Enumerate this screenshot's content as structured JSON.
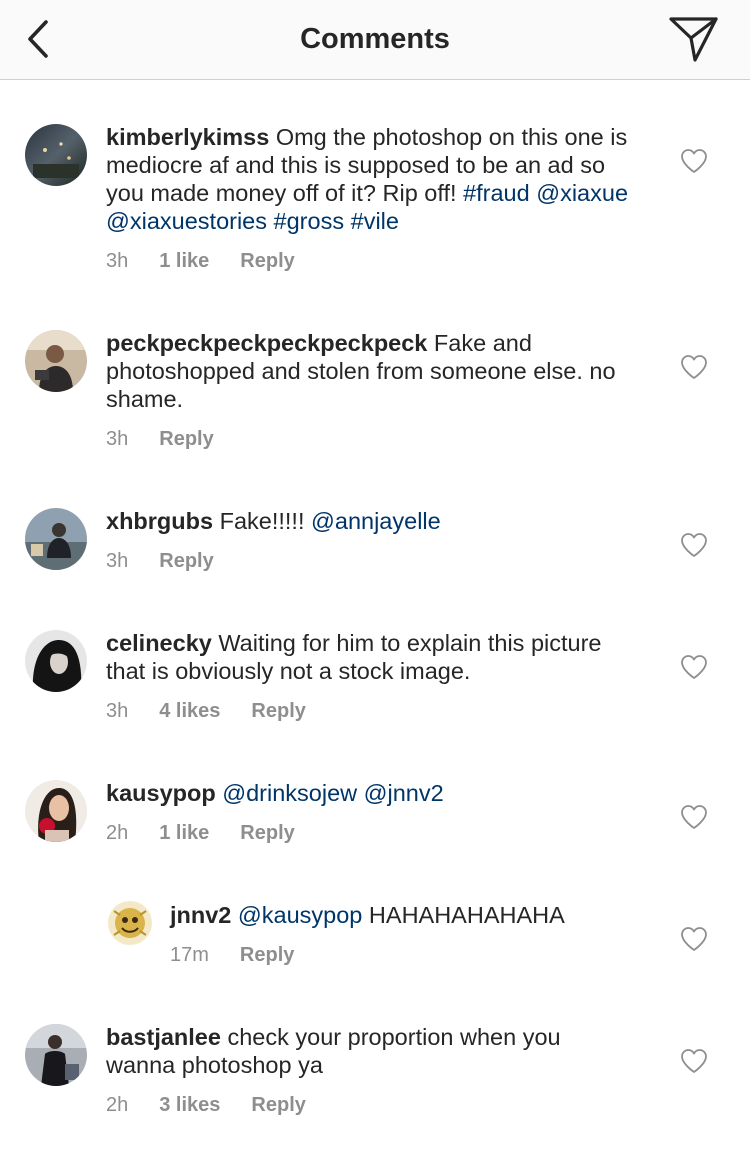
{
  "header": {
    "title": "Comments",
    "back_icon": "chevron-left-icon",
    "send_icon": "paper-plane-icon"
  },
  "colors": {
    "text": "#262626",
    "secondary": "#8e8e8e",
    "link": "#003569",
    "header_bg": "#fafafa",
    "divider": "#cfcfcf"
  },
  "comments": [
    {
      "username": "kimberlykimss",
      "text_before": " Omg the photoshop on this one is mediocre af and this is supposed to be an ad so you made money off of it? Rip off! ",
      "tags": [
        "#fraud",
        "@xiaxue",
        "@xiaxuestories",
        "#gross",
        "#vile"
      ],
      "time": "3h",
      "likes": "1 like",
      "reply": "Reply"
    },
    {
      "username": "peckpeckpeckpeckpeckpeck",
      "text": " Fake and photoshopped and stolen from someone else. no shame.",
      "time": "3h",
      "reply": "Reply"
    },
    {
      "username": "xhbrgubs",
      "text": " Fake!!!!! ",
      "mention": "@annjayelle",
      "time": "3h",
      "reply": "Reply"
    },
    {
      "username": "celinecky",
      "text": " Waiting for him to explain this picture that is obviously not a stock image.",
      "time": "3h",
      "likes": "4 likes",
      "reply": "Reply"
    },
    {
      "username": "kausypop",
      "mentions": [
        "@drinksojew",
        "@jnnv2"
      ],
      "time": "2h",
      "likes": "1 like",
      "reply": "Reply"
    },
    {
      "username": "jnnv2",
      "mention": "@kausypop",
      "text": " HAHAHAHAHAHA",
      "time": "17m",
      "reply": "Reply"
    },
    {
      "username": "bastjanlee",
      "text": " check your proportion when you wanna photoshop ya",
      "time": "2h",
      "likes": "3 likes",
      "reply": "Reply"
    }
  ],
  "icons": {
    "like": "heart-outline-icon"
  }
}
